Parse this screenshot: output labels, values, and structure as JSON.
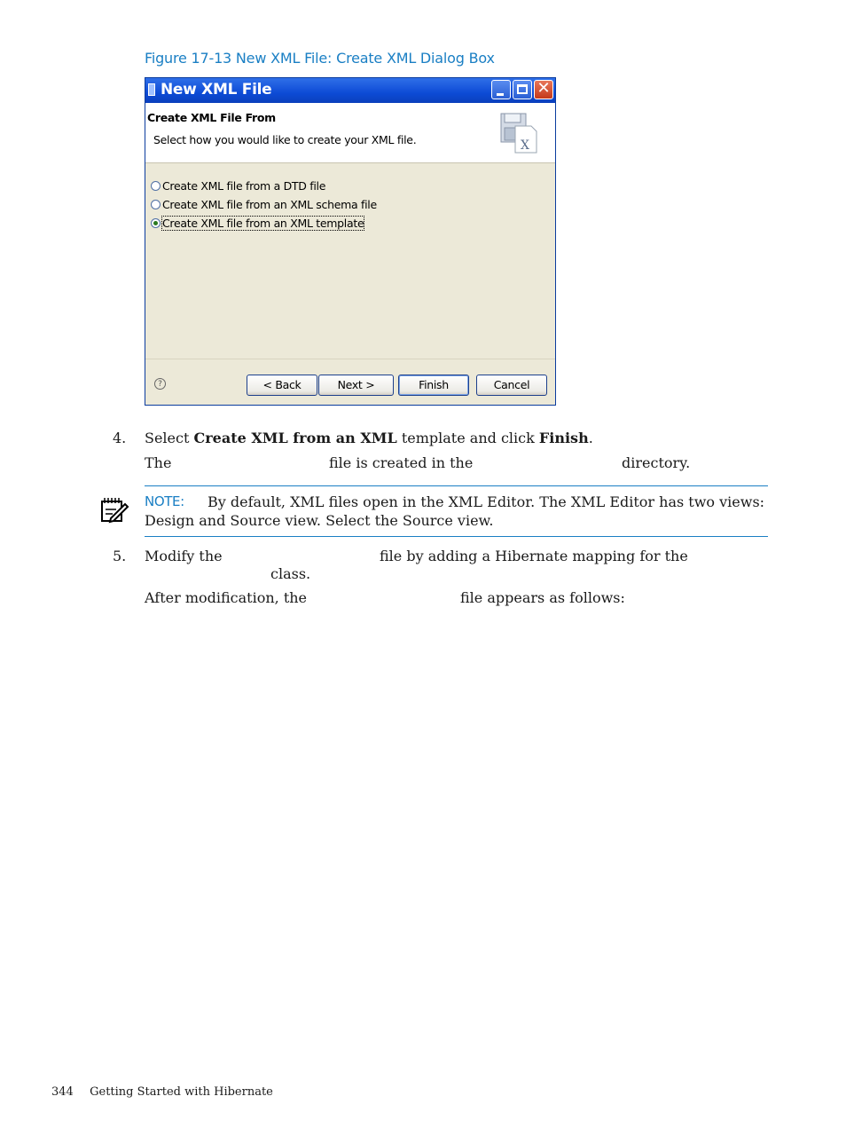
{
  "figure_caption": "Figure 17-13 New XML File: Create XML Dialog Box",
  "dialog": {
    "title": "New XML File",
    "header_title": "Create XML File From",
    "header_subtitle": "Select how you would like to create your XML file.",
    "options": [
      {
        "label": "Create XML file from a DTD file",
        "selected": false
      },
      {
        "label": "Create XML file from an XML schema file",
        "selected": false
      },
      {
        "label": "Create XML file from an XML template",
        "selected": true
      }
    ],
    "help_glyph": "?",
    "buttons": {
      "back": "< Back",
      "next": "Next >",
      "finish": "Finish",
      "cancel": "Cancel"
    },
    "close_glyph": "✕"
  },
  "step4": {
    "number": "4.",
    "text_select": "Select",
    "bold_create": "Create XML from an XML",
    "text_template": "template and click",
    "bold_finish": "Finish",
    "period": ".",
    "line2_the": "The",
    "line2_file_created": "file is created in the",
    "line2_directory": "directory."
  },
  "note": {
    "label": "NOTE:",
    "line1": "By default, XML files open in the XML Editor. The XML Editor has two views:",
    "line2": "Design and Source view. Select the Source view."
  },
  "step5": {
    "number": "5.",
    "modify_the": "Modify the",
    "file_by_adding": "file by adding a Hibernate mapping for the",
    "class": "class.",
    "after_mod": "After modification, the",
    "appears": "file appears as follows:"
  },
  "page_footer": {
    "page_number": "344",
    "section": "Getting Started with Hibernate"
  }
}
